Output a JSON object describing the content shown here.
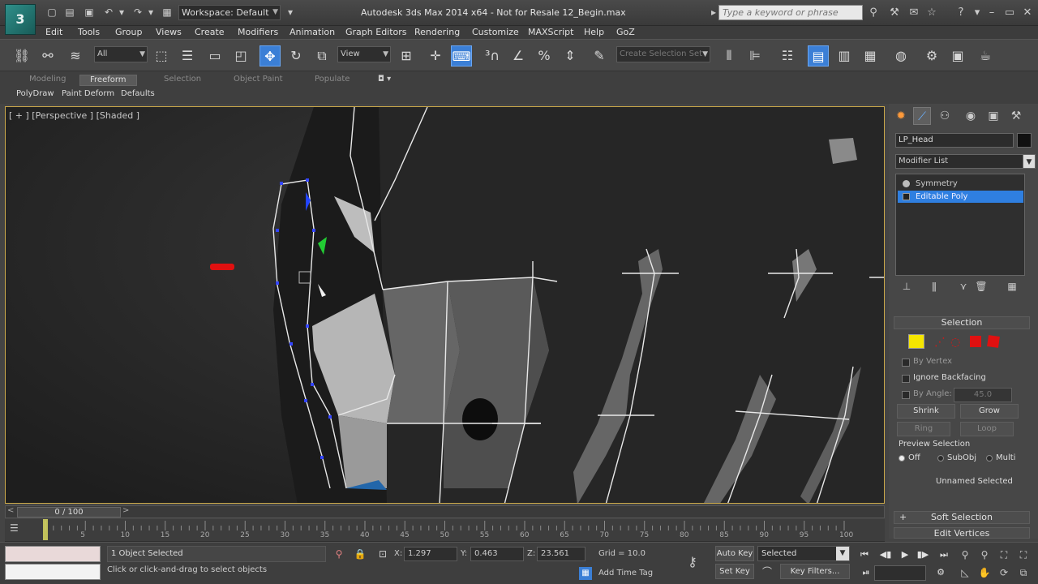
{
  "titlebar": {
    "logo": "3",
    "workspace": "Workspace: Default",
    "title": "Autodesk 3ds Max 2014 x64  -  Not for Resale  12_Begin.max",
    "search_placeholder": "Type a keyword or phrase"
  },
  "menu": [
    "Edit",
    "Tools",
    "Group",
    "Views",
    "Create",
    "Modifiers",
    "Animation",
    "Graph Editors",
    "Rendering",
    "Customize",
    "MAXScript",
    "Help",
    "GoZ"
  ],
  "toolbar": {
    "filter": "All",
    "refcoord": "View",
    "named_sel": "Create Selection Set"
  },
  "ribbon": {
    "tabs": [
      "Modeling",
      "Freeform",
      "Selection",
      "Object Paint",
      "Populate"
    ],
    "selected_tab": "Freeform",
    "subtabs": [
      "PolyDraw",
      "Paint Deform",
      "Defaults"
    ]
  },
  "viewport": {
    "label": "[ + ] [Perspective ] [Shaded ]"
  },
  "command_panel": {
    "object_name": "LP_Head",
    "modifier_list": "Modifier List",
    "stack": [
      {
        "label": "Symmetry",
        "selected": false
      },
      {
        "label": "Editable Poly",
        "selected": true
      }
    ],
    "selection": {
      "title": "Selection",
      "by_vertex": "By Vertex",
      "ignore_backfacing": "Ignore Backfacing",
      "by_angle": "By Angle:",
      "angle_value": "45.0",
      "shrink": "Shrink",
      "grow": "Grow",
      "ring": "Ring",
      "loop": "Loop",
      "preview_title": "Preview Selection",
      "preview_options": [
        "Off",
        "SubObj",
        "Multi"
      ],
      "preview_selected": "Off",
      "status": "Unnamed Selected"
    },
    "soft_selection": "Soft Selection",
    "edit_vertices": "Edit Vertices"
  },
  "timeline": {
    "slider": "0 / 100",
    "ticks": [
      "5",
      "10",
      "15",
      "20",
      "25",
      "30",
      "35",
      "40",
      "45",
      "50",
      "55",
      "60",
      "65",
      "70",
      "75",
      "80",
      "85",
      "90",
      "95",
      "100"
    ],
    "tick_max": 100
  },
  "status": {
    "selection": "1 Object Selected",
    "prompt": "Click or click-and-drag to select objects",
    "x_label": "X:",
    "x": "1.297",
    "y_label": "Y:",
    "y": "0.463",
    "z_label": "Z:",
    "z": "23.561",
    "grid": "Grid = 10.0",
    "add_time_tag": "Add Time Tag",
    "auto_key": "Auto Key",
    "set_key": "Set Key",
    "key_mode": "Selected",
    "key_filters": "Key Filters..."
  },
  "colors": {
    "accent": "#3b7fd6",
    "viewport_border": "#caa84a",
    "selection_highlight": "#2f7fe0",
    "vertex_mode": "#f5e600",
    "element_red": "#e01010"
  }
}
